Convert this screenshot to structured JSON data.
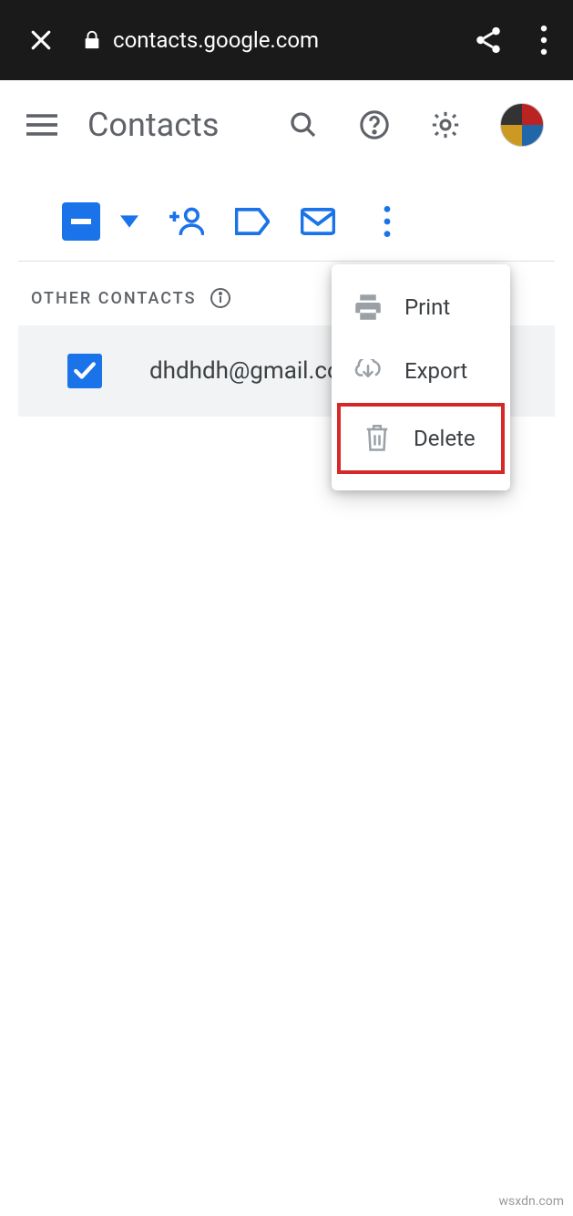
{
  "browser": {
    "url": "contacts.google.com"
  },
  "header": {
    "title": "Contacts"
  },
  "section": {
    "label": "OTHER CONTACTS"
  },
  "contact": {
    "email": "dhdhdh@gmail.com"
  },
  "menu": {
    "print": "Print",
    "export": "Export",
    "delete": "Delete"
  },
  "watermark": "wsxdn.com"
}
